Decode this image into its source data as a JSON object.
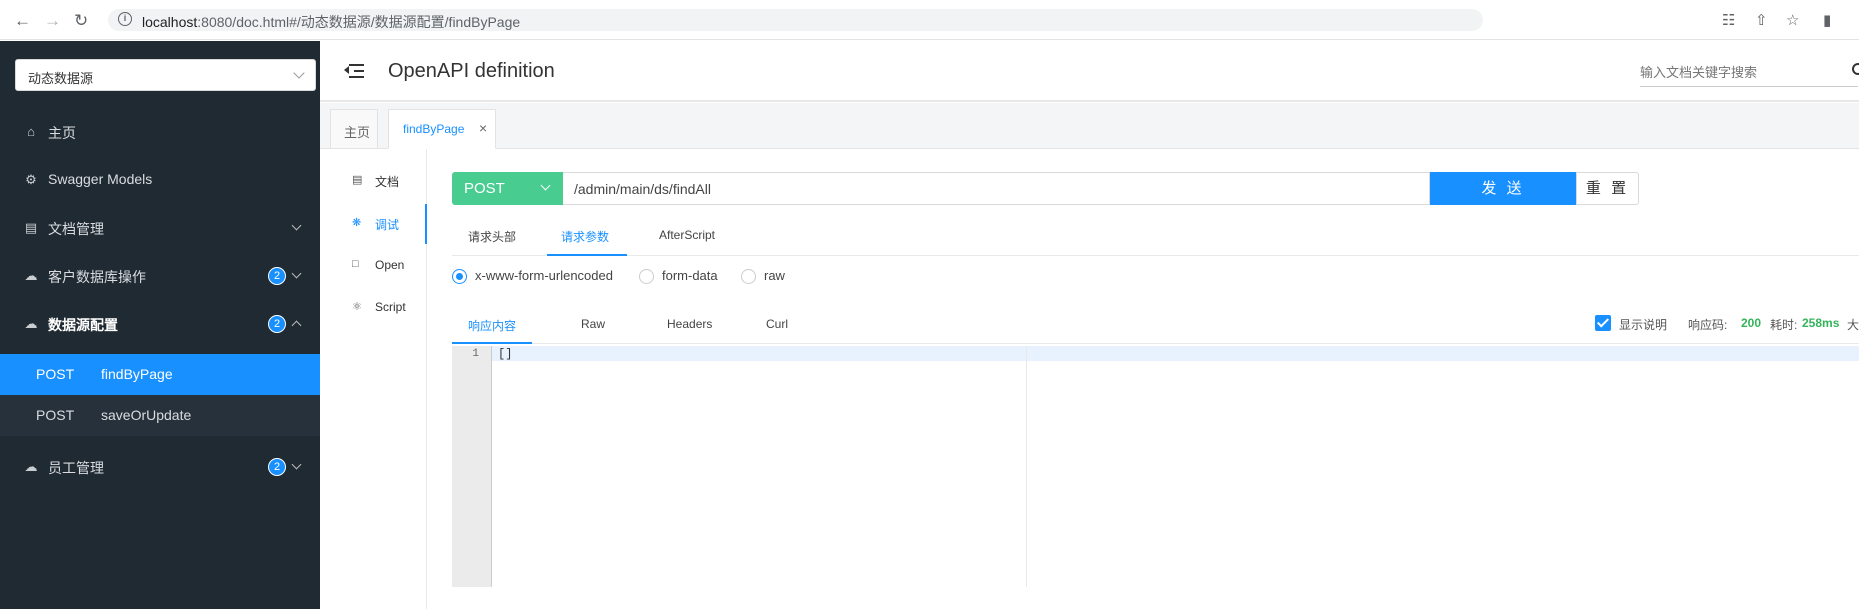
{
  "browser": {
    "url_host": "localhost",
    "url_rest": ":8080/doc.html#/动态数据源/数据源配置/findByPage"
  },
  "sidebar": {
    "datasource_select": "动态数据源",
    "items": [
      {
        "label": "主页",
        "icon": "home-icon"
      },
      {
        "label": "Swagger Models",
        "icon": "gear-icon"
      },
      {
        "label": "文档管理",
        "icon": "document-icon"
      },
      {
        "label": "客户数据库操作",
        "icon": "cloud-icon",
        "badge": "2"
      },
      {
        "label": "数据源配置",
        "icon": "cloud-icon",
        "badge": "2"
      },
      {
        "label": "员工管理",
        "icon": "cloud-icon",
        "badge": "2"
      }
    ],
    "sub_items": [
      {
        "method": "POST",
        "path": "findByPage",
        "active": true
      },
      {
        "method": "POST",
        "path": "saveOrUpdate",
        "active": false
      }
    ]
  },
  "header": {
    "title": "OpenAPI definition",
    "search_placeholder": "输入文档关键字搜索"
  },
  "tabs": {
    "home": "主页",
    "active": "findByPage",
    "close": "×"
  },
  "inner_nav": [
    {
      "label": "文档",
      "icon": "doc-icon"
    },
    {
      "label": "调试",
      "icon": "bug-icon",
      "active": true
    },
    {
      "label": "Open",
      "icon": "file-icon"
    },
    {
      "label": "Script",
      "icon": "script-icon"
    }
  ],
  "request": {
    "method": "POST",
    "url": "/admin/main/ds/findAll",
    "send_label": "发 送",
    "reset_label": "重 置",
    "tabs": [
      "请求头部",
      "请求参数",
      "AfterScript"
    ],
    "active_tab": "请求参数",
    "content_types": [
      "x-www-form-urlencoded",
      "form-data",
      "raw"
    ],
    "selected_content_type": "x-www-form-urlencoded"
  },
  "response": {
    "tabs": [
      "响应内容",
      "Raw",
      "Headers",
      "Curl"
    ],
    "active_tab": "响应内容",
    "show_desc_label": "显示说明",
    "code_label": "响应码:",
    "code_value": "200",
    "time_label": "耗时:",
    "time_value": "258ms",
    "size_label": "大",
    "line_number": "1",
    "body": "[]"
  },
  "colors": {
    "sidebar_bg": "#202a33",
    "accent": "#1890ff",
    "post_green": "#49cc90",
    "status_green": "#34b35a"
  }
}
